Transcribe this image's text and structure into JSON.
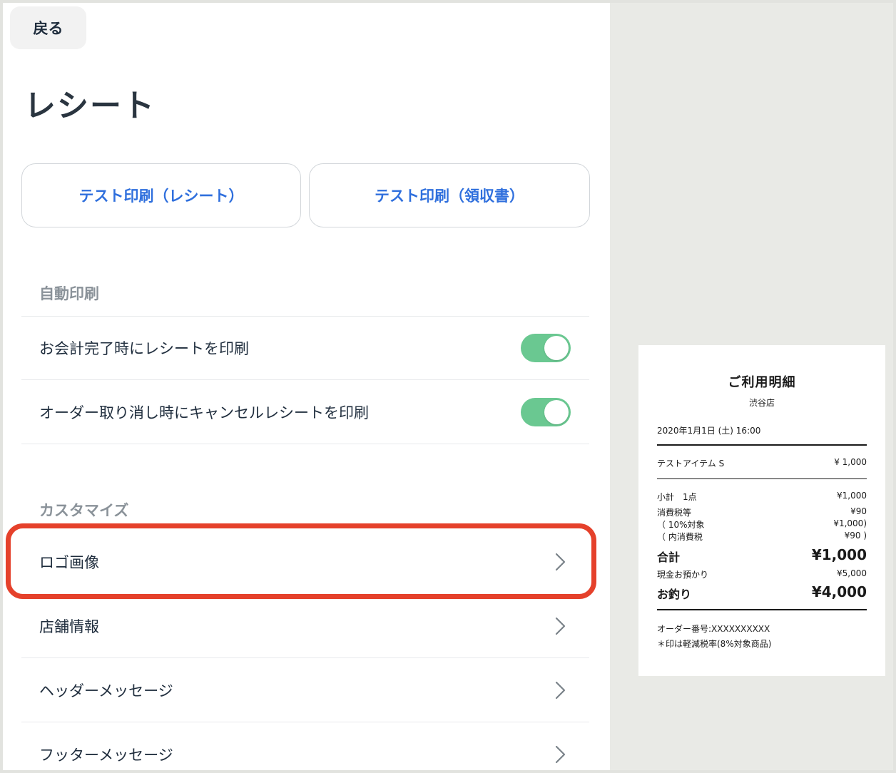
{
  "back_button": {
    "label": "戻る"
  },
  "page_title": "レシート",
  "test_buttons": {
    "receipt": "テスト印刷（レシート）",
    "invoice": "テスト印刷（領収書）"
  },
  "auto_print": {
    "header": "自動印刷",
    "items": [
      {
        "label": "お会計完了時にレシートを印刷",
        "enabled": true
      },
      {
        "label": "オーダー取り消し時にキャンセルレシートを印刷",
        "enabled": true
      }
    ]
  },
  "customize": {
    "header": "カスタマイズ",
    "items": [
      {
        "label": "ロゴ画像",
        "highlighted": true
      },
      {
        "label": "店舗情報"
      },
      {
        "label": "ヘッダーメッセージ"
      },
      {
        "label": "フッターメッセージ"
      }
    ]
  },
  "colors": {
    "accent_blue": "#2f6fdd",
    "toggle_on": "#6ac891",
    "highlight": "#e5412b"
  },
  "receipt_preview": {
    "title": "ご利用明細",
    "store": "渋谷店",
    "datetime": "2020年1月1日 (土) 16:00",
    "item": {
      "name": "テストアイテム S",
      "price": "¥ 1,000"
    },
    "subtotal": {
      "label": "小計　1点",
      "value": "¥1,000"
    },
    "tax": {
      "label": "消費税等",
      "value": "¥90"
    },
    "tax_target": {
      "label": "（ 10%対象",
      "value": "¥1,000)"
    },
    "tax_included": {
      "label": "（ 内消費税",
      "value": "¥90 )"
    },
    "total": {
      "label": "合計",
      "value": "¥1,000"
    },
    "cash": {
      "label": "現金お預かり",
      "value": "¥5,000"
    },
    "change": {
      "label": "お釣り",
      "value": "¥4,000"
    },
    "order_number": "オーダー番号:XXXXXXXXXX",
    "reduced_tax_note": "＊印は軽減税率(8%対象商品)"
  }
}
